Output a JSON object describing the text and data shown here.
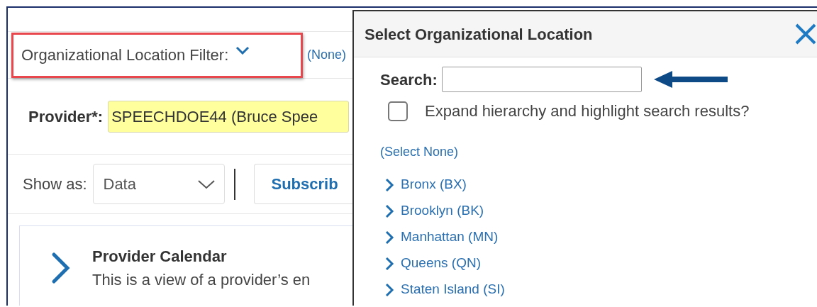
{
  "filter": {
    "label": "Organizational Location Filter:",
    "value": "(None)"
  },
  "provider": {
    "label": "Provider*:",
    "value": "SPEECHDOE44 (Bruce Spee"
  },
  "show_as": {
    "label": "Show as:",
    "value": "Data"
  },
  "subscribe_button": {
    "label": "Subscrib"
  },
  "card": {
    "title": "Provider Calendar",
    "description": "This is a view of a provider’s en"
  },
  "dialog": {
    "title": "Select Organizational Location",
    "search": {
      "label": "Search:"
    },
    "expand_option": {
      "label": "Expand hierarchy and highlight search results?",
      "checked": false
    },
    "select_none": "(Select None)",
    "tree": [
      {
        "label": "Bronx (BX)",
        "expanded": false
      },
      {
        "label": "Brooklyn (BK)",
        "expanded": false
      },
      {
        "label": "Manhattan (MN)",
        "expanded": false
      },
      {
        "label": "Queens (QN)",
        "expanded": false
      },
      {
        "label": "Staten Island (SI)",
        "expanded": false
      }
    ]
  }
}
